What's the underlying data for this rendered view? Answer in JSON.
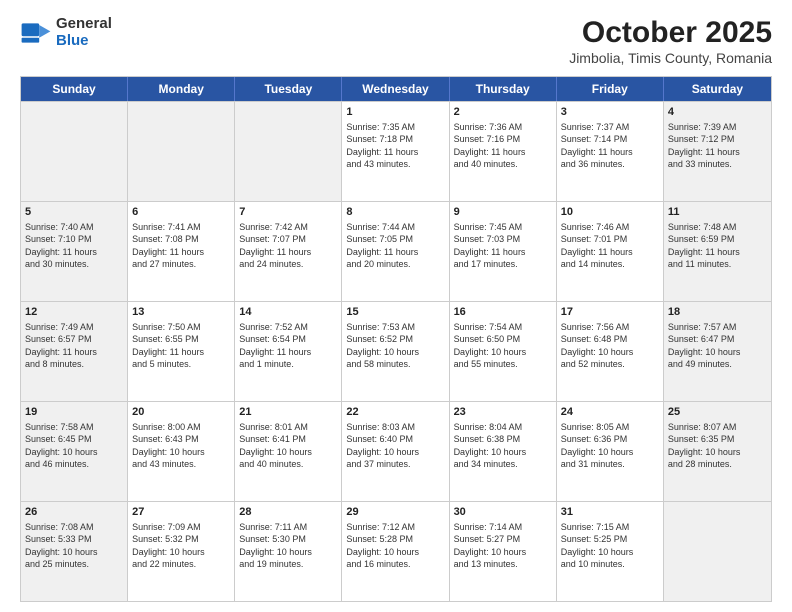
{
  "header": {
    "logo_general": "General",
    "logo_blue": "Blue",
    "main_title": "October 2025",
    "subtitle": "Jimbolia, Timis County, Romania"
  },
  "days_of_week": [
    "Sunday",
    "Monday",
    "Tuesday",
    "Wednesday",
    "Thursday",
    "Friday",
    "Saturday"
  ],
  "weeks": [
    [
      {
        "day": "",
        "text": "",
        "shaded": true
      },
      {
        "day": "",
        "text": "",
        "shaded": true
      },
      {
        "day": "",
        "text": "",
        "shaded": true
      },
      {
        "day": "1",
        "text": "Sunrise: 7:35 AM\nSunset: 7:18 PM\nDaylight: 11 hours\nand 43 minutes.",
        "shaded": false
      },
      {
        "day": "2",
        "text": "Sunrise: 7:36 AM\nSunset: 7:16 PM\nDaylight: 11 hours\nand 40 minutes.",
        "shaded": false
      },
      {
        "day": "3",
        "text": "Sunrise: 7:37 AM\nSunset: 7:14 PM\nDaylight: 11 hours\nand 36 minutes.",
        "shaded": false
      },
      {
        "day": "4",
        "text": "Sunrise: 7:39 AM\nSunset: 7:12 PM\nDaylight: 11 hours\nand 33 minutes.",
        "shaded": true
      }
    ],
    [
      {
        "day": "5",
        "text": "Sunrise: 7:40 AM\nSunset: 7:10 PM\nDaylight: 11 hours\nand 30 minutes.",
        "shaded": true
      },
      {
        "day": "6",
        "text": "Sunrise: 7:41 AM\nSunset: 7:08 PM\nDaylight: 11 hours\nand 27 minutes.",
        "shaded": false
      },
      {
        "day": "7",
        "text": "Sunrise: 7:42 AM\nSunset: 7:07 PM\nDaylight: 11 hours\nand 24 minutes.",
        "shaded": false
      },
      {
        "day": "8",
        "text": "Sunrise: 7:44 AM\nSunset: 7:05 PM\nDaylight: 11 hours\nand 20 minutes.",
        "shaded": false
      },
      {
        "day": "9",
        "text": "Sunrise: 7:45 AM\nSunset: 7:03 PM\nDaylight: 11 hours\nand 17 minutes.",
        "shaded": false
      },
      {
        "day": "10",
        "text": "Sunrise: 7:46 AM\nSunset: 7:01 PM\nDaylight: 11 hours\nand 14 minutes.",
        "shaded": false
      },
      {
        "day": "11",
        "text": "Sunrise: 7:48 AM\nSunset: 6:59 PM\nDaylight: 11 hours\nand 11 minutes.",
        "shaded": true
      }
    ],
    [
      {
        "day": "12",
        "text": "Sunrise: 7:49 AM\nSunset: 6:57 PM\nDaylight: 11 hours\nand 8 minutes.",
        "shaded": true
      },
      {
        "day": "13",
        "text": "Sunrise: 7:50 AM\nSunset: 6:55 PM\nDaylight: 11 hours\nand 5 minutes.",
        "shaded": false
      },
      {
        "day": "14",
        "text": "Sunrise: 7:52 AM\nSunset: 6:54 PM\nDaylight: 11 hours\nand 1 minute.",
        "shaded": false
      },
      {
        "day": "15",
        "text": "Sunrise: 7:53 AM\nSunset: 6:52 PM\nDaylight: 10 hours\nand 58 minutes.",
        "shaded": false
      },
      {
        "day": "16",
        "text": "Sunrise: 7:54 AM\nSunset: 6:50 PM\nDaylight: 10 hours\nand 55 minutes.",
        "shaded": false
      },
      {
        "day": "17",
        "text": "Sunrise: 7:56 AM\nSunset: 6:48 PM\nDaylight: 10 hours\nand 52 minutes.",
        "shaded": false
      },
      {
        "day": "18",
        "text": "Sunrise: 7:57 AM\nSunset: 6:47 PM\nDaylight: 10 hours\nand 49 minutes.",
        "shaded": true
      }
    ],
    [
      {
        "day": "19",
        "text": "Sunrise: 7:58 AM\nSunset: 6:45 PM\nDaylight: 10 hours\nand 46 minutes.",
        "shaded": true
      },
      {
        "day": "20",
        "text": "Sunrise: 8:00 AM\nSunset: 6:43 PM\nDaylight: 10 hours\nand 43 minutes.",
        "shaded": false
      },
      {
        "day": "21",
        "text": "Sunrise: 8:01 AM\nSunset: 6:41 PM\nDaylight: 10 hours\nand 40 minutes.",
        "shaded": false
      },
      {
        "day": "22",
        "text": "Sunrise: 8:03 AM\nSunset: 6:40 PM\nDaylight: 10 hours\nand 37 minutes.",
        "shaded": false
      },
      {
        "day": "23",
        "text": "Sunrise: 8:04 AM\nSunset: 6:38 PM\nDaylight: 10 hours\nand 34 minutes.",
        "shaded": false
      },
      {
        "day": "24",
        "text": "Sunrise: 8:05 AM\nSunset: 6:36 PM\nDaylight: 10 hours\nand 31 minutes.",
        "shaded": false
      },
      {
        "day": "25",
        "text": "Sunrise: 8:07 AM\nSunset: 6:35 PM\nDaylight: 10 hours\nand 28 minutes.",
        "shaded": true
      }
    ],
    [
      {
        "day": "26",
        "text": "Sunrise: 7:08 AM\nSunset: 5:33 PM\nDaylight: 10 hours\nand 25 minutes.",
        "shaded": true
      },
      {
        "day": "27",
        "text": "Sunrise: 7:09 AM\nSunset: 5:32 PM\nDaylight: 10 hours\nand 22 minutes.",
        "shaded": false
      },
      {
        "day": "28",
        "text": "Sunrise: 7:11 AM\nSunset: 5:30 PM\nDaylight: 10 hours\nand 19 minutes.",
        "shaded": false
      },
      {
        "day": "29",
        "text": "Sunrise: 7:12 AM\nSunset: 5:28 PM\nDaylight: 10 hours\nand 16 minutes.",
        "shaded": false
      },
      {
        "day": "30",
        "text": "Sunrise: 7:14 AM\nSunset: 5:27 PM\nDaylight: 10 hours\nand 13 minutes.",
        "shaded": false
      },
      {
        "day": "31",
        "text": "Sunrise: 7:15 AM\nSunset: 5:25 PM\nDaylight: 10 hours\nand 10 minutes.",
        "shaded": false
      },
      {
        "day": "",
        "text": "",
        "shaded": true
      }
    ]
  ]
}
